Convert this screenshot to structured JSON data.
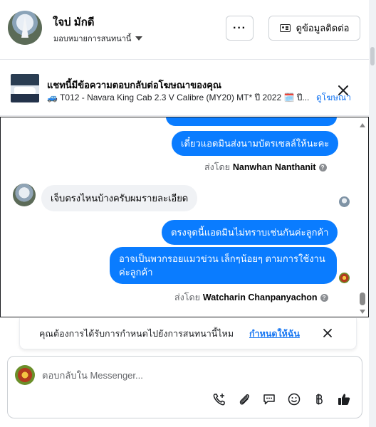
{
  "header": {
    "contact_name": "ใจบ่ มักดี",
    "assigned_label": "มอบหมายการสนทนานี้",
    "more_label": "···",
    "contact_info_button": "ดูข้อมูลติดต่อ"
  },
  "ad_banner": {
    "title": "แชทนี้มีข้อความตอบกลับต่อโฆษณาของคุณ",
    "subtitle": "🚙 T012 - Navara King Cab 2.3 V Calibre (MY20) MT* ปี 2022 🗓️ ปี...",
    "link": "ดูโฆษณา"
  },
  "messages": {
    "partial_top_text": "",
    "out1": "เดี๋ยวแอดมินส่งนามบัตรเซลล์ให้นะคะ",
    "sent_by_prefix_1": "ส่งโดย",
    "sender_1": "Nanwhan Nanthanit",
    "in1": "เจ็บตรงไหนบ้างครับผมรายละเอียด",
    "out2": "ตรงจุดนี้แอดมินไม่ทราบเช่นกันค่ะลูกค้า",
    "out3": "อาจเป็นพวกรอยแมวข่วน เล็กๆน้อยๆ ตามการใช้งาน ค่ะลูกค้า",
    "sent_by_prefix_2": "ส่งโดย",
    "sender_2": "Watcharin Chanpanyachon",
    "info_glyph": "?"
  },
  "assign_prompt": {
    "text": "คุณต้องการได้รับการกำหนดไปยังการสนทนานี้ไหม",
    "link": "กำหนดให้ฉัน"
  },
  "composer": {
    "placeholder": "ตอบกลับใน Messenger...",
    "tools": [
      "call-add-icon",
      "attachment-icon",
      "saved-reply-icon",
      "emoji-icon",
      "baht-icon",
      "like-icon"
    ]
  },
  "colors": {
    "outgoing_bubble": "#0a7cff",
    "incoming_bubble": "#f0f2f5",
    "link": "#1877f2"
  }
}
